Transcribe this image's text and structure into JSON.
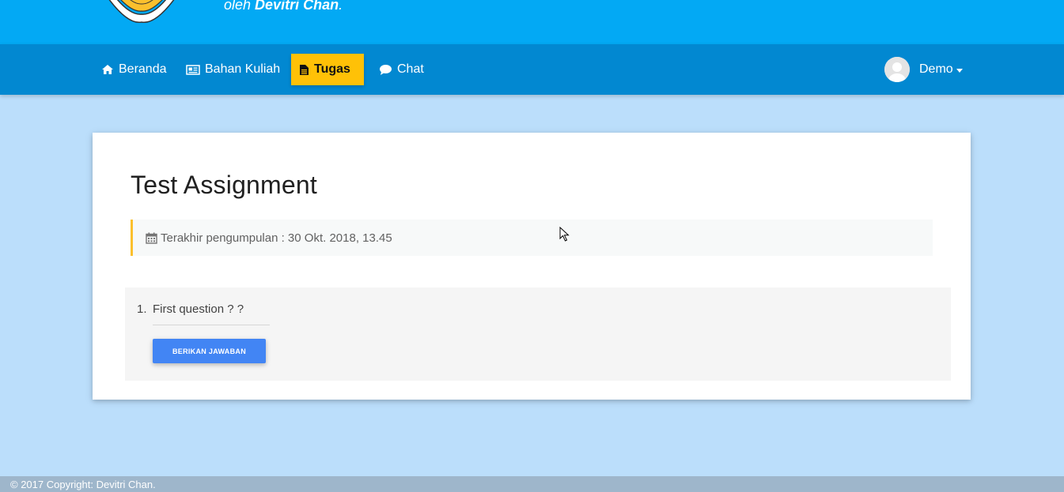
{
  "banner": {
    "tagline_prefix": "oleh ",
    "tagline_author": "Devitri Chan",
    "tagline_suffix": ".",
    "logo_icon": "book-emblem-logo"
  },
  "navbar": {
    "items": [
      {
        "label": "Beranda",
        "icon": "home-icon"
      },
      {
        "label": "Bahan Kuliah",
        "icon": "newspaper-icon"
      },
      {
        "label": "Tugas",
        "icon": "file-text-icon",
        "active": true
      },
      {
        "label": "Chat",
        "icon": "comment-icon"
      }
    ],
    "user": {
      "name": "Demo",
      "icon": "avatar"
    }
  },
  "assignment": {
    "title": "Test Assignment",
    "deadline": "Terakhir pengumpulan : 30 Okt. 2018, 13.45",
    "deadline_icon": "calendar-icon",
    "questions": [
      {
        "number": "1.",
        "text": "First question ? ?",
        "button_label": "BERIKAN JAWABAN"
      }
    ]
  },
  "footer": {
    "copyright": "© 2017 Copyright: Devitri Chan."
  },
  "colors": {
    "banner": "#03a9f4",
    "navbar": "#0288d1",
    "active_tab": "#ffc107",
    "page_bg": "#bbdefb",
    "button": "#4285f4",
    "footer": "#9eb6cb"
  }
}
